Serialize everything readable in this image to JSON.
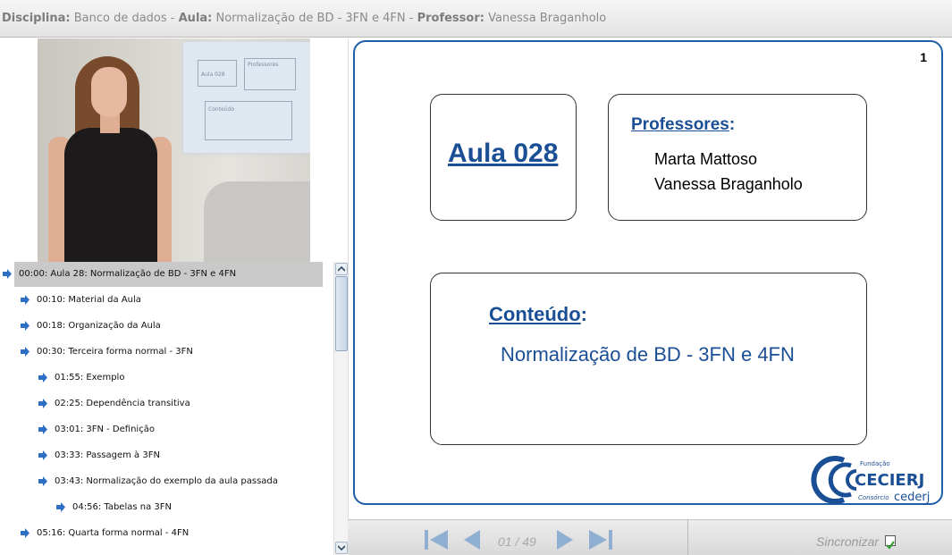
{
  "header": {
    "disciplina_label": "Disciplina:",
    "disciplina_value": " Banco de dados - ",
    "aula_label": "Aula:",
    "aula_value": " Normalização de BD - 3FN e 4FN - ",
    "professor_label": "Professor:",
    "professor_value": " Vanessa Braganholo"
  },
  "video": {
    "screen_title": "Aula 028",
    "screen_prof": "Professores",
    "screen_content": "Conteúdo"
  },
  "index": {
    "items": [
      {
        "time_label": "00:00: Aula 28: Normalização de BD - 3FN e 4FN",
        "level": 0,
        "selected": true
      },
      {
        "time_label": "00:10: Material da Aula",
        "level": 1
      },
      {
        "time_label": "00:18: Organização da Aula",
        "level": 1
      },
      {
        "time_label": "00:30: Terceira forma normal - 3FN",
        "level": 1
      },
      {
        "time_label": "01:55: Exemplo",
        "level": 2
      },
      {
        "time_label": "02:25: Dependência transitiva",
        "level": 2
      },
      {
        "time_label": "03:01: 3FN - Definição",
        "level": 2
      },
      {
        "time_label": "03:33: Passagem à 3FN",
        "level": 2
      },
      {
        "time_label": "03:43: Normalização do exemplo da aula passada",
        "level": 2
      },
      {
        "time_label": "04:56: Tabelas na 3FN",
        "level": 3
      },
      {
        "time_label": "05:16: Quarta forma normal - 4FN",
        "level": 1
      }
    ]
  },
  "slide": {
    "number": "1",
    "aula_title": "Aula 028",
    "professores_label": "Professores",
    "professores_colon": ":",
    "professores": [
      "Marta Mattoso",
      "Vanessa Braganholo"
    ],
    "conteudo_label": "Conteúdo",
    "conteudo_colon": ":",
    "conteudo_text": "Normalização de BD - 3FN e 4FN",
    "logo_fundacao": "Fundação",
    "logo_name": "CECIERJ",
    "logo_consorcio": "Consórcio",
    "logo_cederj": "cederj"
  },
  "navigation": {
    "page_indicator": "01 / 49",
    "sync_label": "Sincronizar",
    "sync_checked": true
  },
  "colors": {
    "accent_blue": "#1b4f95",
    "frame_blue": "#1f5fa8",
    "arrow_blue": "#2c6fc4",
    "selected_row": "#c9c9c9",
    "nav_icon": "#8fb0d2"
  }
}
